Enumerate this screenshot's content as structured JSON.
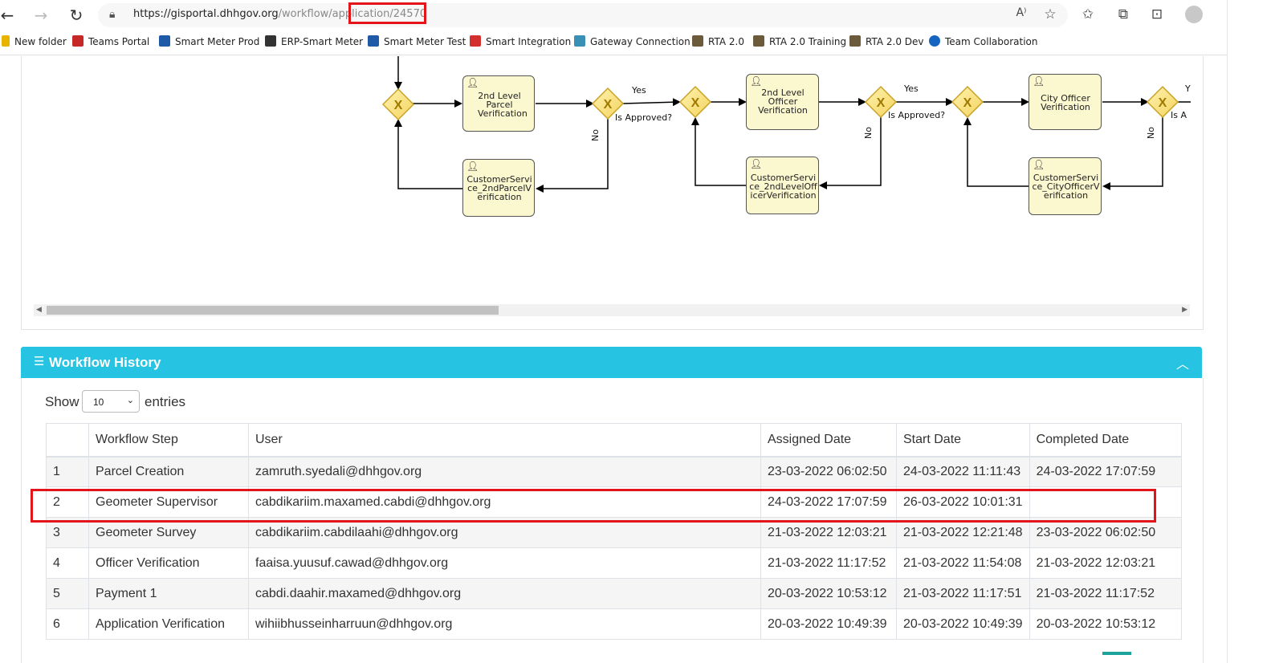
{
  "browser": {
    "url_host": "https://gisportal.dhhgov.org",
    "url_path": "/workflow/application/24570",
    "bookmarks": [
      {
        "label": "New folder",
        "color": "#e8b400"
      },
      {
        "label": "Teams Portal",
        "color": "#c62828"
      },
      {
        "label": "Smart Meter Prod",
        "color": "#1e5aa8"
      },
      {
        "label": "ERP-Smart Meter",
        "color": "#333333"
      },
      {
        "label": "Smart Meter Test",
        "color": "#1e5aa8"
      },
      {
        "label": "Smart Integration",
        "color": "#d32f2f"
      },
      {
        "label": "Gateway Connection",
        "color": "#3a8fb7"
      },
      {
        "label": "RTA 2.0",
        "color": "#6b5b3a"
      },
      {
        "label": "RTA 2.0 Training",
        "color": "#6b5b3a"
      },
      {
        "label": "RTA 2.0 Dev",
        "color": "#6b5b3a"
      },
      {
        "label": "Team Collaboration",
        "color": "#1565c0"
      }
    ]
  },
  "diagram": {
    "tasks": {
      "t1": "2nd Level Parcel Verification",
      "t2": "CustomerService_2ndParcelVerification",
      "t3": "2nd Level Officer Verification",
      "t4": "CustomerService_2ndLevelOfficerVerification",
      "t5": "City Officer Verification",
      "t6": "CustomerService_CityOfficerVerification"
    },
    "labels": {
      "yes": "Yes",
      "no": "No",
      "is_approved": "Is Approved?",
      "is_approved_cut": "Is A",
      "yes_cut": "Y",
      "gateway": "X"
    }
  },
  "workflow_history": {
    "title": "Workflow History",
    "show_label": "Show",
    "page_size": "10",
    "entries_label": "entries",
    "columns": [
      "",
      "Workflow Step",
      "User",
      "Assigned Date",
      "Start Date",
      "Completed Date"
    ],
    "rows": [
      [
        "1",
        "Parcel Creation",
        "zamruth.syedali@dhhgov.org",
        "23-03-2022 06:02:50",
        "24-03-2022 11:11:43",
        "24-03-2022 17:07:59"
      ],
      [
        "2",
        "Geometer Supervisor",
        "cabdikariim.maxamed.cabdi@dhhgov.org",
        "24-03-2022 17:07:59",
        "26-03-2022 10:01:31",
        ""
      ],
      [
        "3",
        "Geometer Survey",
        "cabdikariim.cabdilaahi@dhhgov.org",
        "21-03-2022 12:03:21",
        "21-03-2022 12:21:48",
        "23-03-2022 06:02:50"
      ],
      [
        "4",
        "Officer Verification",
        "faaisa.yuusuf.cawad@dhhgov.org",
        "21-03-2022 11:17:52",
        "21-03-2022 11:54:08",
        "21-03-2022 12:03:21"
      ],
      [
        "5",
        "Payment 1",
        "cabdi.daahir.maxamed@dhhgov.org",
        "20-03-2022 10:53:12",
        "21-03-2022 11:17:51",
        "21-03-2022 11:17:52"
      ],
      [
        "6",
        "Application Verification",
        "wihiibhusseinharruun@dhhgov.org",
        "20-03-2022 10:49:39",
        "20-03-2022 10:49:39",
        "20-03-2022 10:53:12"
      ]
    ]
  }
}
